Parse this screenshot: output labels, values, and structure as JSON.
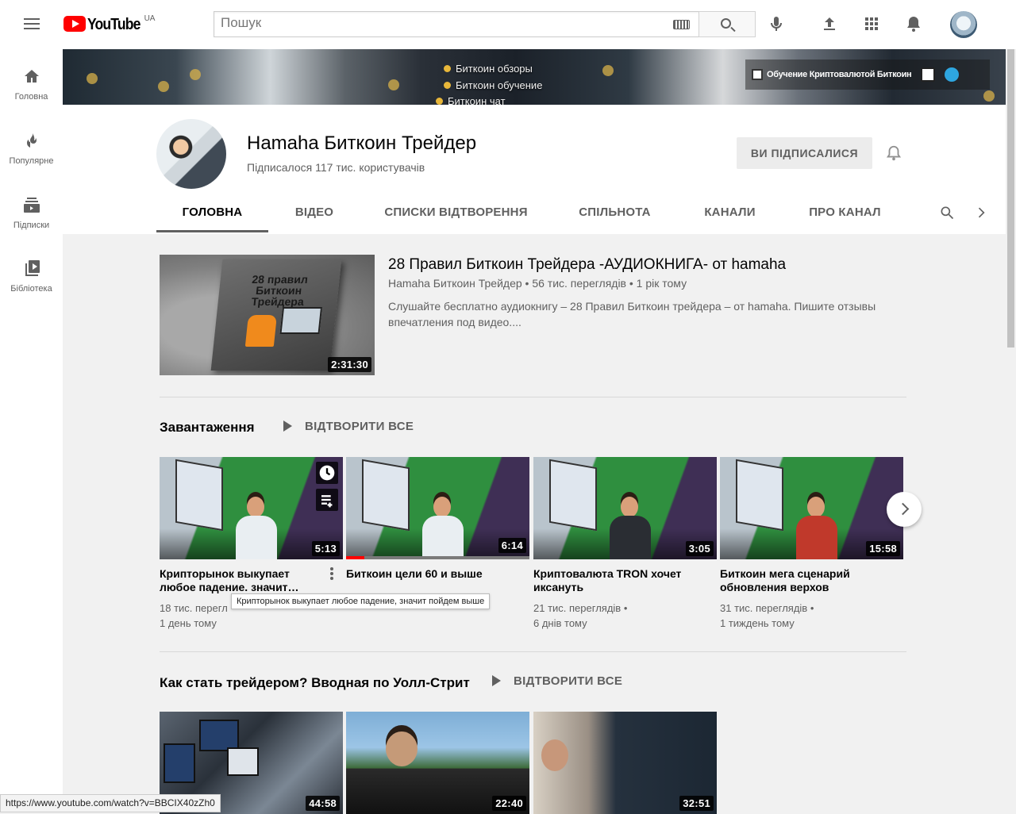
{
  "header": {
    "logo_text": "YouTube",
    "region": "UA",
    "search_placeholder": "Пошук",
    "icons": [
      "menu-icon",
      "keyboard-icon",
      "search-icon",
      "mic-icon",
      "upload-icon",
      "apps-icon",
      "notifications-icon",
      "avatar"
    ]
  },
  "sidebar": {
    "items": [
      {
        "label": "Головна",
        "icon": "home-icon"
      },
      {
        "label": "Популярне",
        "icon": "trending-icon"
      },
      {
        "label": "Підписки",
        "icon": "subscriptions-icon"
      },
      {
        "label": "Бібліотека",
        "icon": "library-icon"
      }
    ]
  },
  "banner": {
    "lines": [
      "Биткоин обзоры",
      "Биткоин обучение",
      "Биткоин чат"
    ],
    "link_text": "Обучение Криптовалютой Биткоин"
  },
  "channel": {
    "name": "Hamaha Биткоин Трейдер",
    "subscribers": "Підписалося 117 тис. користувачів",
    "subscribe_label": "ВИ ПІДПИСАЛИСЯ",
    "tabs": [
      "ГОЛОВНА",
      "ВІДЕО",
      "СПИСКИ ВІДТВОРЕННЯ",
      "СПІЛЬНОТА",
      "КАНАЛИ",
      "ПРО КАНАЛ"
    ],
    "active_tab": "ГОЛОВНА"
  },
  "featured": {
    "thumb_title": "28 правил Биткоин Трейдера",
    "duration": "2:31:30",
    "title": "28 Правил Биткоин Трейдера -АУДИОКНИГА- от hamaha",
    "meta": "Hamaha Биткоин Трейдер • 56 тис. переглядів • 1 рік тому",
    "description": "Слушайте бесплатно аудиокнигу – 28 Правил Биткоин трейдера – от hamaha. Пишите отзывы впечатления под видео...."
  },
  "uploads": {
    "title": "Завантаження",
    "play_all": "ВІДТВОРИТИ ВСЕ",
    "videos": [
      {
        "title": "Крипторынок выкупает любое падение. значит…",
        "duration": "5:13",
        "views": "18 тис. перегл",
        "age": "1 день тому"
      },
      {
        "title": "Биткоин цели 60 и выше",
        "duration": "6:14",
        "views": "",
        "age": "",
        "progress": 0.1
      },
      {
        "title": "Криптовалюта TRON хочет иксануть",
        "duration": "3:05",
        "views": "21 тис. переглядів •",
        "age": "6 днів тому"
      },
      {
        "title": "Биткоин мега сценарий обновления верхов",
        "duration": "15:58",
        "views": "31 тис. переглядів •",
        "age": "1 тиждень тому"
      }
    ],
    "tooltip": "Крипторынок выкупает любое падение, значит пойдем выше"
  },
  "shelf2": {
    "title": "Как стать трейдером? Вводная по Уолл-Стрит",
    "play_all": "ВІДТВОРИТИ ВСЕ",
    "durations": [
      "44:58",
      "22:40",
      "32:51"
    ]
  },
  "status_url": "https://www.youtube.com/watch?v=BBCIX40zZh0",
  "colors": {
    "accent": "#ff0000",
    "text": "#030303",
    "secondary": "#606060",
    "background": "#f1f1f1"
  }
}
